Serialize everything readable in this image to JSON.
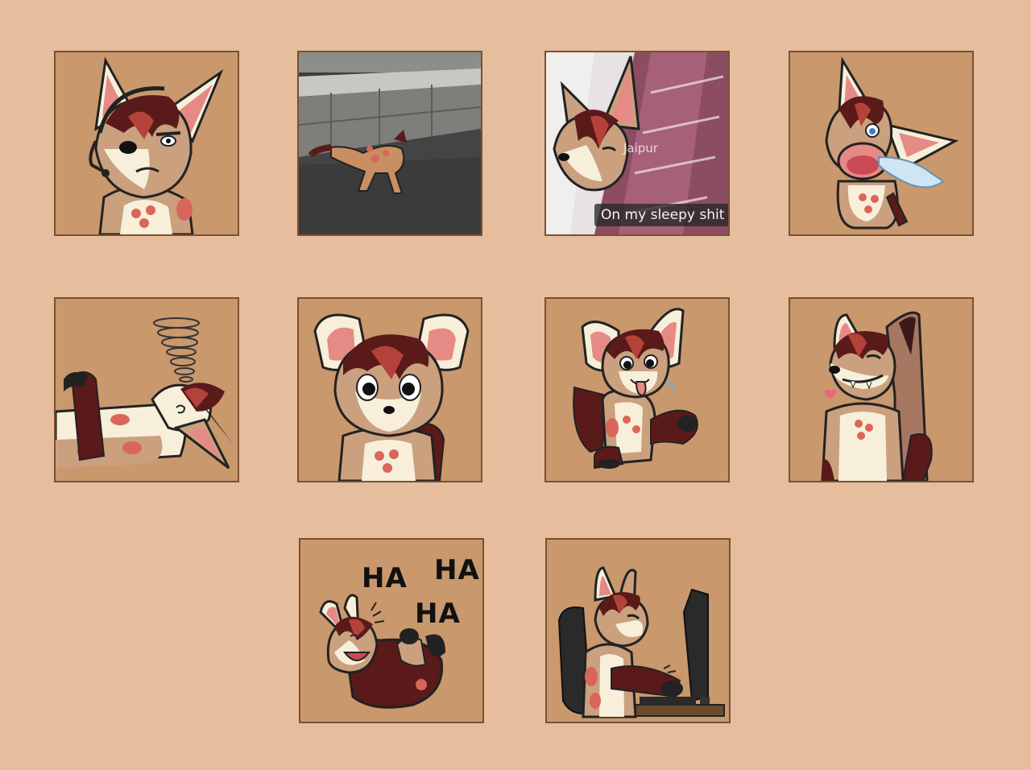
{
  "colors": {
    "page_background": "#e6bd9d",
    "tile_background": "#c9986d",
    "tile_border": "#7a5032",
    "fur_light": "#f7efd9",
    "fur_tan": "#caa07f",
    "fur_dark": "#5a1a1a",
    "spots": "#d9665a",
    "hair_red": "#b5423a"
  },
  "stickers": [
    {
      "pose": "headset-smirk"
    },
    {
      "pose": "photo-walking-sidewalk"
    },
    {
      "pose": "photo-sleepy-on-rug",
      "caption": "On my sleepy shit rn",
      "watermark": "Jaipur"
    },
    {
      "pose": "crying-hug-tissue"
    },
    {
      "pose": "dizzy-lying-down"
    },
    {
      "pose": "blank-stare"
    },
    {
      "pose": "happy-waving"
    },
    {
      "pose": "flirty-grin-heart"
    },
    {
      "pose": "laughing-rolling",
      "sfx": [
        "HA",
        "HA",
        "HA"
      ]
    },
    {
      "pose": "gaming-at-computer"
    }
  ]
}
